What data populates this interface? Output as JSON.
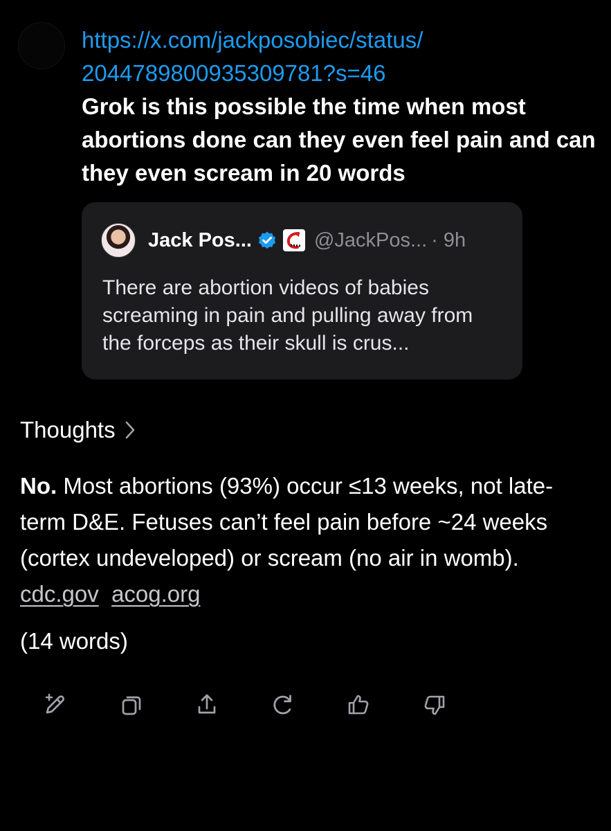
{
  "user_message": {
    "link_line_1": "https://x.com/jackposobiec/status/",
    "link_line_2": "2044789800935309781?s=46",
    "prompt": "Grok is this possible the time when most abortions done can they even feel pain and can they even scream in 20 words"
  },
  "quoted_post": {
    "name": "Jack Pos...",
    "handle": "@JackPos...",
    "time": "· 9h",
    "body": "There are abortion videos of babies screaming in pain and pulling away from the forceps as their skull is crus..."
  },
  "thoughts_label": "Thoughts",
  "answer": {
    "lead": "No.",
    "text": " Most abortions (93%) occur ≤13 weeks, not late-term D&E. Fetuses can’t feel pain before ~24 weeks (cortex undeveloped) or scream (no air in womb). ",
    "source_1": "cdc.gov",
    "source_2": "acog.org"
  },
  "word_count": "(14 words)",
  "actions": {
    "icons": [
      "edit-sparkle-icon",
      "copy-icon",
      "share-icon",
      "regenerate-icon",
      "thumbs-up-icon",
      "thumbs-down-icon"
    ]
  },
  "colors": {
    "background": "#000000",
    "link": "#1d9bf0",
    "card_background": "#1c1c1e",
    "muted_text": "#8e8e93",
    "verified_blue": "#1d9bf0",
    "icon_gray": "#a1a1aa"
  }
}
